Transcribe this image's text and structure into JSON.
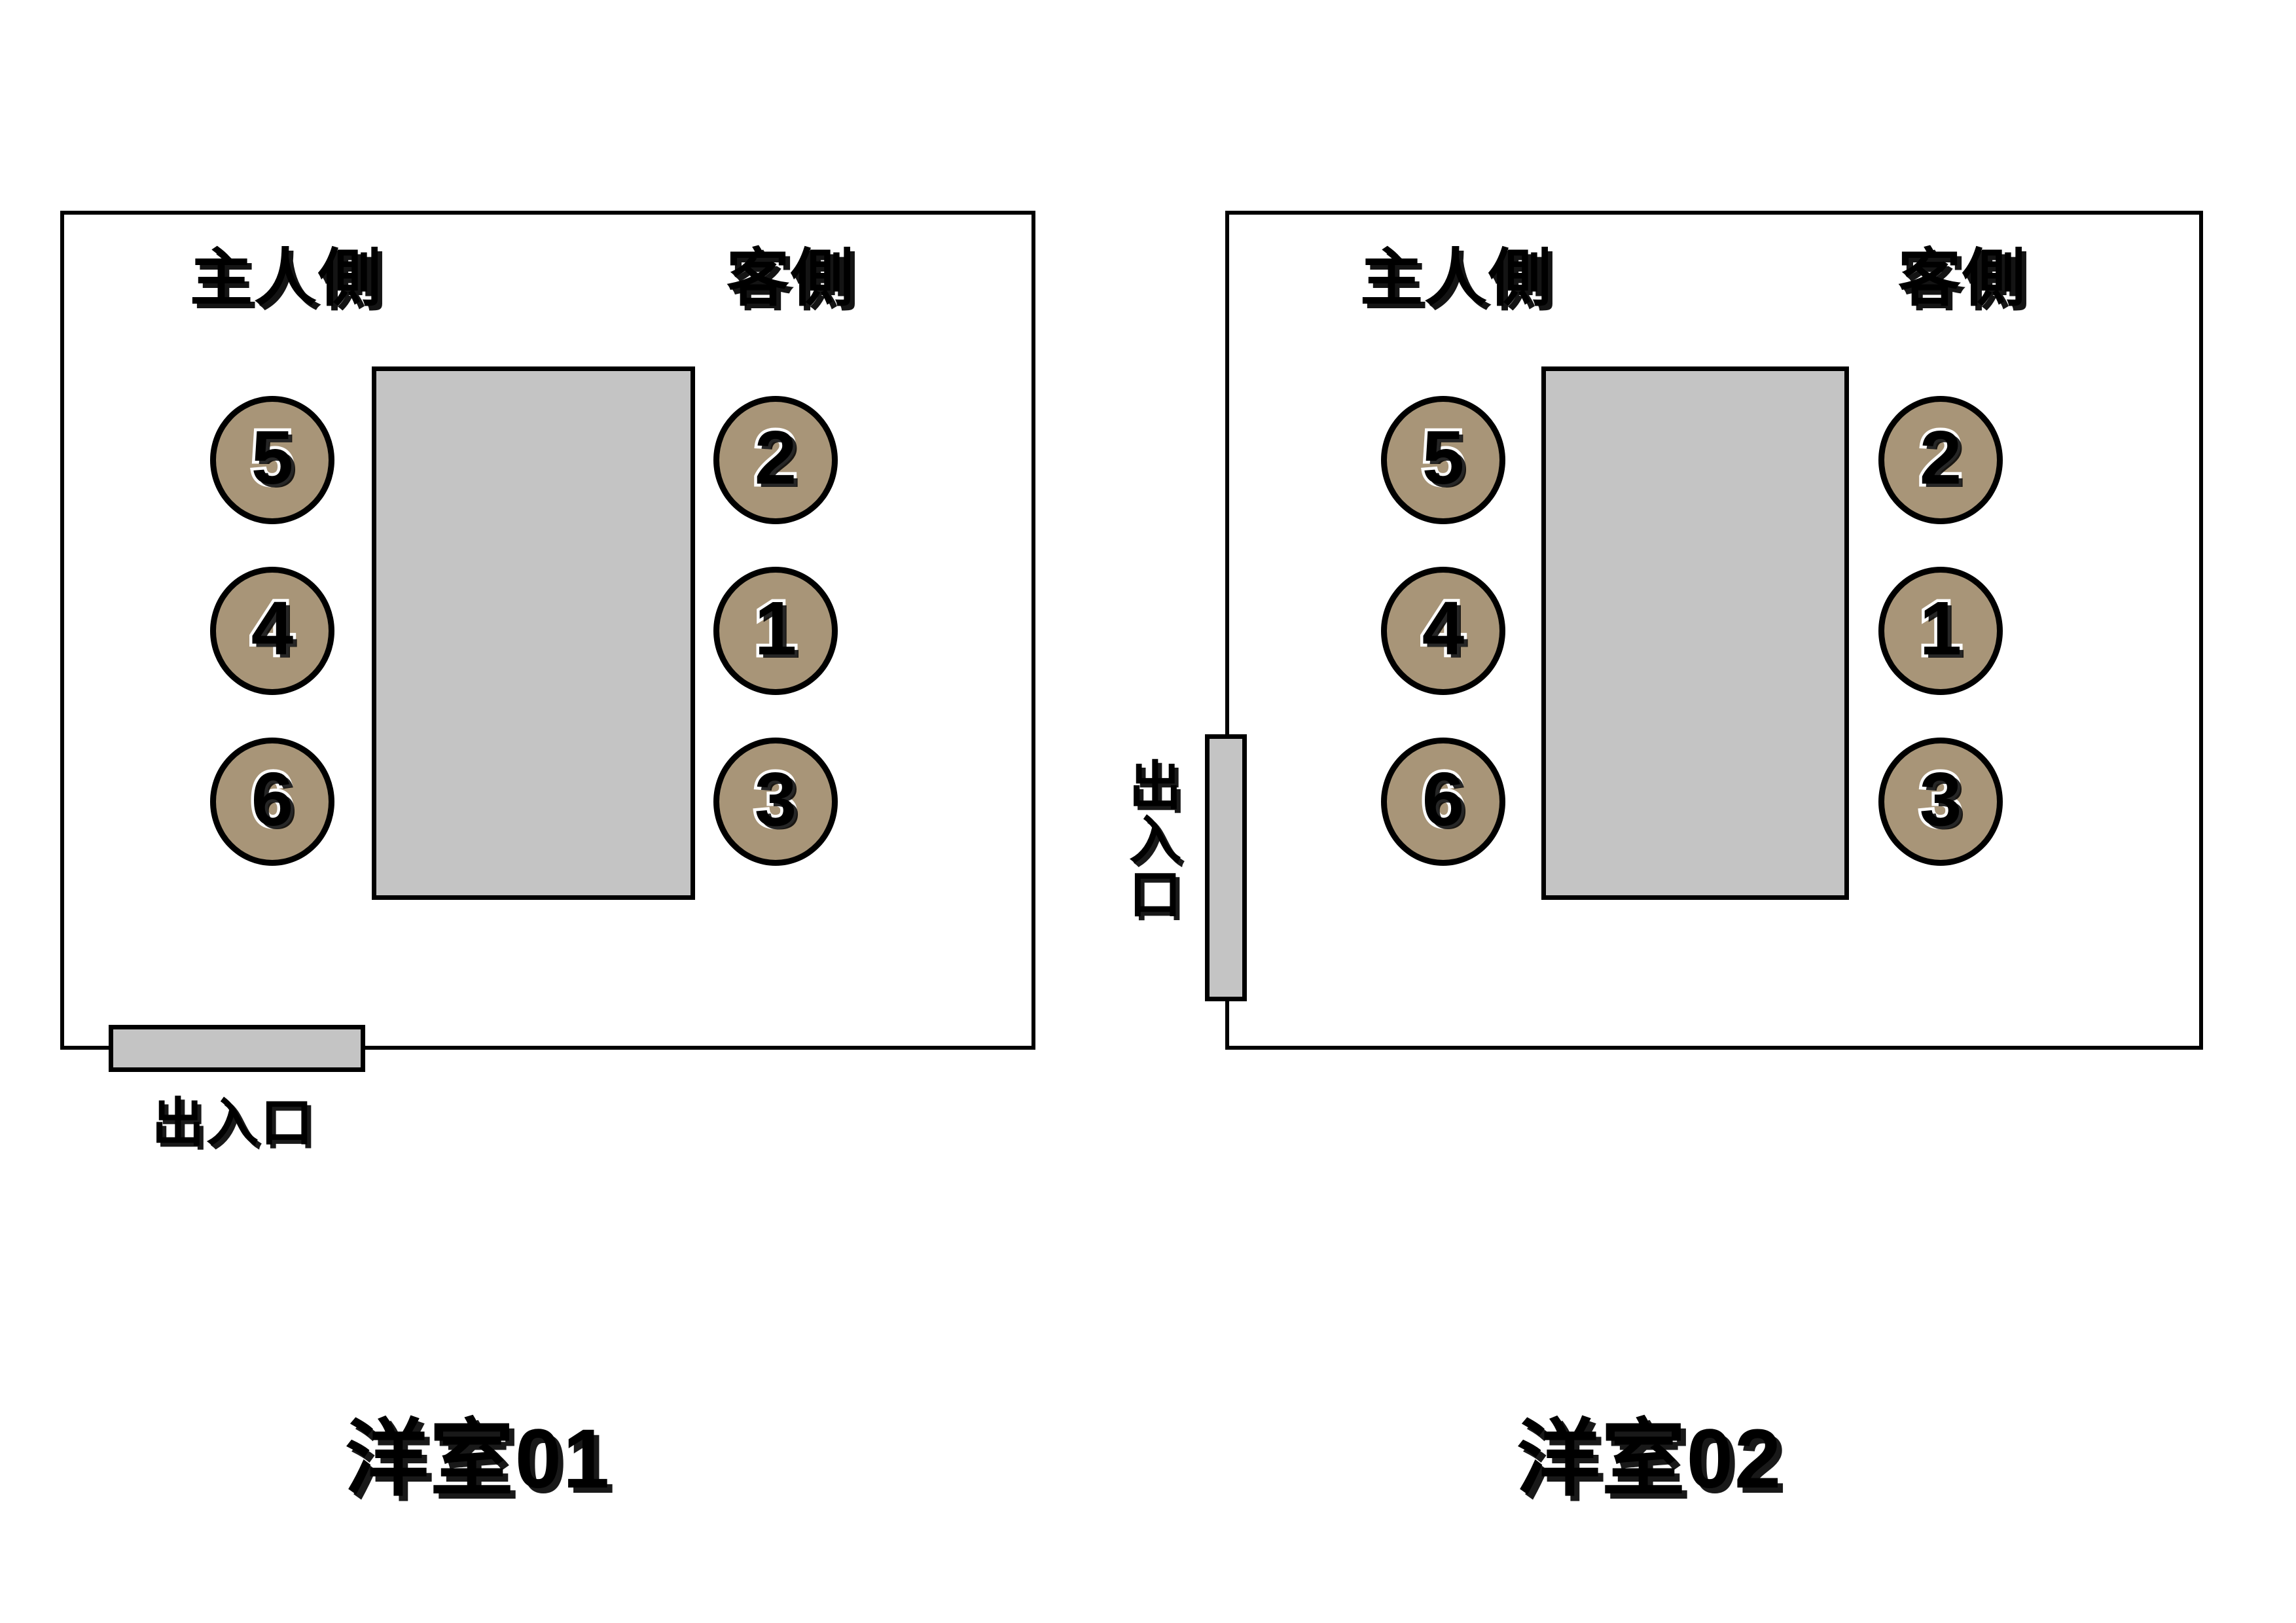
{
  "diagram": {
    "title_room_01": "洋室01",
    "title_room_02": "洋室02",
    "host_side_label": "主人側",
    "guest_side_label": "客側",
    "entrance_label": "出入口",
    "colors": {
      "seat_fill": "#A89578",
      "seat_stroke": "#000000",
      "table_fill": "#C4C4C4",
      "door_fill": "#C4C4C4",
      "wall_stroke": "#000000",
      "room_fill": "#FFFFFF",
      "number_fill": "#000000",
      "number_outline": "#FFFFFF"
    }
  },
  "rooms": [
    {
      "id": "room-01",
      "name": "洋室01",
      "host_side_label": "主人側",
      "guest_side_label": "客側",
      "entrance_label": "出入口",
      "entrance_position": "bottom-wall",
      "table_label": "",
      "host_seats": [
        "5",
        "4",
        "6"
      ],
      "guest_seats": [
        "2",
        "1",
        "3"
      ]
    },
    {
      "id": "room-02",
      "name": "洋室02",
      "host_side_label": "主人側",
      "guest_side_label": "客側",
      "entrance_label": "出入口",
      "entrance_position": "left-wall",
      "table_label": "",
      "host_seats": [
        "5",
        "4",
        "6"
      ],
      "guest_seats": [
        "2",
        "1",
        "3"
      ]
    }
  ]
}
